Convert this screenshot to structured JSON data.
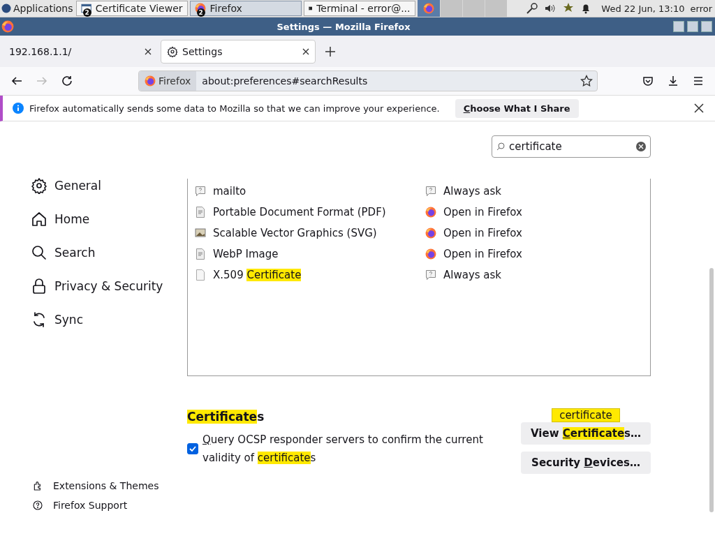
{
  "taskbar": {
    "menu": "Applications",
    "windows": [
      {
        "title": "Certificate Viewer",
        "badge": "2",
        "selected": false
      },
      {
        "title": "Firefox",
        "badge": "2",
        "selected": true
      },
      {
        "title": "Terminal - error@...",
        "selected": false
      }
    ],
    "clock": "Wed 22 Jun, 13:10",
    "user": "error"
  },
  "window": {
    "title": "Settings — Mozilla Firefox"
  },
  "tabs": [
    {
      "label": "192.168.1.1/",
      "selected": false
    },
    {
      "label": "Settings",
      "selected": true
    }
  ],
  "address_bar": {
    "identity": "Firefox",
    "url": "about:preferences#searchResults"
  },
  "notification": {
    "message": "Firefox automatically sends some data to Mozilla so that we can improve your experience.",
    "button": [
      {
        "kind": "key",
        "text": "C"
      },
      {
        "kind": "plain",
        "text": "hoose What I Share"
      }
    ]
  },
  "search": {
    "value": "certificate"
  },
  "sidebar": {
    "items": [
      {
        "label": "General",
        "selected": false
      },
      {
        "label": "Home",
        "selected": false
      },
      {
        "label": "Search",
        "selected": false
      },
      {
        "label": "Privacy & Security",
        "selected": false
      },
      {
        "label": "Sync",
        "selected": false
      }
    ],
    "footer": [
      {
        "label": "Extensions & Themes"
      },
      {
        "label": "Firefox Support"
      }
    ]
  },
  "applications": [
    {
      "type": [
        {
          "kind": "plain",
          "text": "mailto"
        }
      ],
      "action": "Always ask"
    },
    {
      "type": [
        {
          "kind": "plain",
          "text": "Portable Document Format (PDF)"
        }
      ],
      "action": "Open in Firefox"
    },
    {
      "type": [
        {
          "kind": "plain",
          "text": "Scalable Vector Graphics (SVG)"
        }
      ],
      "action": "Open in Firefox"
    },
    {
      "type": [
        {
          "kind": "plain",
          "text": "WebP Image"
        }
      ],
      "action": "Open in Firefox"
    },
    {
      "type": [
        {
          "kind": "plain",
          "text": "X.509 "
        },
        {
          "kind": "match",
          "text": "Certificate"
        }
      ],
      "action": "Always ask"
    }
  ],
  "certificates": {
    "heading": [
      {
        "kind": "match",
        "text": "Certificate"
      },
      {
        "kind": "plain",
        "text": "s"
      }
    ],
    "ocsp": {
      "checked": true,
      "label": [
        {
          "kind": "key",
          "text": "Q"
        },
        {
          "kind": "plain",
          "text": "uery OCSP responder servers to confirm the current validity of "
        },
        {
          "kind": "match",
          "text": "certificate"
        },
        {
          "kind": "plain",
          "text": "s"
        }
      ]
    },
    "tooltip": "certificate",
    "buttons": [
      [
        {
          "kind": "plain",
          "text": "View "
        },
        {
          "kind": "match-key",
          "text": "C"
        },
        {
          "kind": "match",
          "text": "ertificate"
        },
        {
          "kind": "plain",
          "text": "s…"
        }
      ],
      [
        {
          "kind": "plain",
          "text": "Security "
        },
        {
          "kind": "key",
          "text": "D"
        },
        {
          "kind": "plain",
          "text": "evices…"
        }
      ]
    ]
  }
}
